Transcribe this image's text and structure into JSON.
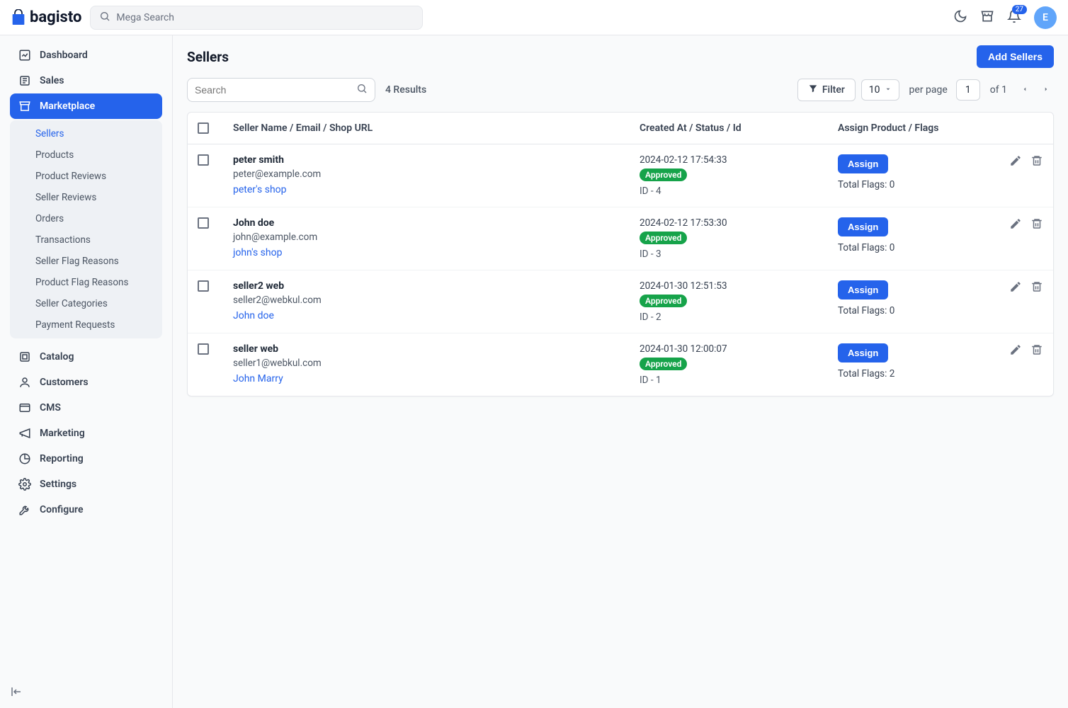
{
  "brand": "bagisto",
  "search": {
    "mega_placeholder": "Mega Search",
    "grid_placeholder": "Search"
  },
  "header": {
    "notifications": "27",
    "avatar_initial": "E"
  },
  "sidebar": {
    "items": [
      {
        "label": "Dashboard"
      },
      {
        "label": "Sales"
      },
      {
        "label": "Marketplace"
      },
      {
        "label": "Catalog"
      },
      {
        "label": "Customers"
      },
      {
        "label": "CMS"
      },
      {
        "label": "Marketing"
      },
      {
        "label": "Reporting"
      },
      {
        "label": "Settings"
      },
      {
        "label": "Configure"
      }
    ],
    "marketplace_sub": [
      {
        "label": "Sellers"
      },
      {
        "label": "Products"
      },
      {
        "label": "Product Reviews"
      },
      {
        "label": "Seller Reviews"
      },
      {
        "label": "Orders"
      },
      {
        "label": "Transactions"
      },
      {
        "label": "Seller Flag Reasons"
      },
      {
        "label": "Product Flag Reasons"
      },
      {
        "label": "Seller Categories"
      },
      {
        "label": "Payment Requests"
      }
    ]
  },
  "page": {
    "title": "Sellers",
    "add_button": "Add Sellers",
    "results_text": "4 Results",
    "filter_label": "Filter",
    "perpage_value": "10",
    "perpage_label": "per page",
    "page_current": "1",
    "page_of": "of 1"
  },
  "columns": {
    "c1": "Seller Name / Email / Shop URL",
    "c2": "Created At / Status / Id",
    "c3": "Assign Product / Flags"
  },
  "labels": {
    "assign": "Assign",
    "flags_prefix": "Total Flags: ",
    "id_prefix": "ID - "
  },
  "rows": [
    {
      "name": "peter smith",
      "email": "peter@example.com",
      "shop": "peter's shop",
      "created": "2024-02-12 17:54:33",
      "status": "Approved",
      "id": "4",
      "flags": "0"
    },
    {
      "name": "John doe",
      "email": "john@example.com",
      "shop": "john's shop",
      "created": "2024-02-12 17:53:30",
      "status": "Approved",
      "id": "3",
      "flags": "0"
    },
    {
      "name": "seller2 web",
      "email": "seller2@webkul.com",
      "shop": "John doe",
      "created": "2024-01-30 12:51:53",
      "status": "Approved",
      "id": "2",
      "flags": "0"
    },
    {
      "name": "seller web",
      "email": "seller1@webkul.com",
      "shop": "John Marry",
      "created": "2024-01-30 12:00:07",
      "status": "Approved",
      "id": "1",
      "flags": "2"
    }
  ]
}
